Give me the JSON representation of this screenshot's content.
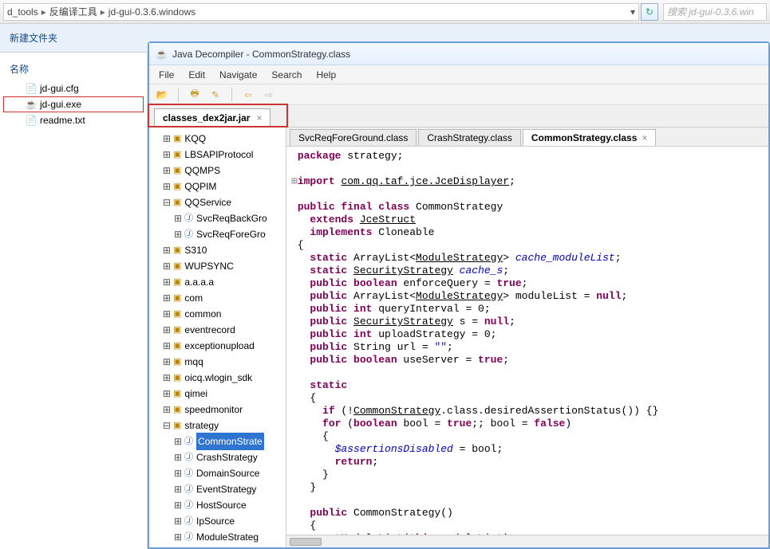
{
  "addr": {
    "seg1": "d_tools",
    "seg2": "反编译工具",
    "seg3": "jd-gui-0.3.6.windows"
  },
  "search_placeholder": "搜索 jd-gui-0.3.6.win",
  "exp_toolbar": {
    "new_folder": "新建文件夹"
  },
  "explorer": {
    "col_name": "名称",
    "files": [
      {
        "name": "jd-gui.cfg",
        "sel": false,
        "type": "file"
      },
      {
        "name": "jd-gui.exe",
        "sel": true,
        "type": "exe"
      },
      {
        "name": "readme.txt",
        "sel": false,
        "type": "file"
      }
    ]
  },
  "jd": {
    "title": "Java Decompiler - CommonStrategy.class",
    "menu": {
      "file": "File",
      "edit": "Edit",
      "navigate": "Navigate",
      "search": "Search",
      "help": "Help"
    },
    "file_tab": "classes_dex2jar.jar",
    "tree": [
      {
        "lvl": 1,
        "kind": "pkg",
        "exp": "+",
        "label": "KQQ"
      },
      {
        "lvl": 1,
        "kind": "pkg",
        "exp": "+",
        "label": "LBSAPIProtocol"
      },
      {
        "lvl": 1,
        "kind": "pkg",
        "exp": "+",
        "label": "QQMPS"
      },
      {
        "lvl": 1,
        "kind": "pkg",
        "exp": "+",
        "label": "QQPIM"
      },
      {
        "lvl": 1,
        "kind": "pkg",
        "exp": "-",
        "label": "QQService"
      },
      {
        "lvl": 2,
        "kind": "cls",
        "exp": "+",
        "label": "SvcReqBackGro"
      },
      {
        "lvl": 2,
        "kind": "cls",
        "exp": "+",
        "label": "SvcReqForeGro"
      },
      {
        "lvl": 1,
        "kind": "pkg",
        "exp": "+",
        "label": "S310"
      },
      {
        "lvl": 1,
        "kind": "pkg",
        "exp": "+",
        "label": "WUPSYNC"
      },
      {
        "lvl": 1,
        "kind": "pkg",
        "exp": "+",
        "label": "a.a.a.a"
      },
      {
        "lvl": 1,
        "kind": "pkg",
        "exp": "+",
        "label": "com"
      },
      {
        "lvl": 1,
        "kind": "pkg",
        "exp": "+",
        "label": "common"
      },
      {
        "lvl": 1,
        "kind": "pkg",
        "exp": "+",
        "label": "eventrecord"
      },
      {
        "lvl": 1,
        "kind": "pkg",
        "exp": "+",
        "label": "exceptionupload"
      },
      {
        "lvl": 1,
        "kind": "pkg",
        "exp": "+",
        "label": "mqq"
      },
      {
        "lvl": 1,
        "kind": "pkg",
        "exp": "+",
        "label": "oicq.wlogin_sdk"
      },
      {
        "lvl": 1,
        "kind": "pkg",
        "exp": "+",
        "label": "qimei"
      },
      {
        "lvl": 1,
        "kind": "pkg",
        "exp": "+",
        "label": "speedmonitor"
      },
      {
        "lvl": 1,
        "kind": "pkg",
        "exp": "-",
        "label": "strategy"
      },
      {
        "lvl": 2,
        "kind": "cls",
        "exp": "+",
        "label": "CommonStrate",
        "sel": true
      },
      {
        "lvl": 2,
        "kind": "cls",
        "exp": "+",
        "label": "CrashStrategy"
      },
      {
        "lvl": 2,
        "kind": "cls",
        "exp": "+",
        "label": "DomainSource"
      },
      {
        "lvl": 2,
        "kind": "cls",
        "exp": "+",
        "label": "EventStrategy"
      },
      {
        "lvl": 2,
        "kind": "cls",
        "exp": "+",
        "label": "HostSource"
      },
      {
        "lvl": 2,
        "kind": "cls",
        "exp": "+",
        "label": "IpSource"
      },
      {
        "lvl": 2,
        "kind": "cls",
        "exp": "+",
        "label": "ModuleStrateg"
      }
    ],
    "class_tabs": [
      {
        "label": "SvcReqForeGround.class",
        "active": false
      },
      {
        "label": "CrashStrategy.class",
        "active": false
      },
      {
        "label": "CommonStrategy.class",
        "active": true
      }
    ],
    "code": {
      "l1": "package strategy;",
      "l3": "import com.qq.taf.jce.JceDisplayer;",
      "l5": "public final class CommonStrategy",
      "l6": "  extends JceStruct",
      "l7": "  implements Cloneable",
      "l9": "  static ArrayList<ModuleStrategy> cache_moduleList;",
      "l10": "  static SecurityStrategy cache_s;",
      "l11": "  public boolean enforceQuery = true;",
      "l12": "  public ArrayList<ModuleStrategy> moduleList = null;",
      "l13": "  public int queryInterval = 0;",
      "l14": "  public SecurityStrategy s = null;",
      "l15": "  public int uploadStrategy = 0;",
      "l16": "  public String url = \"\";",
      "l17": "  public boolean useServer = true;",
      "l19": "  static",
      "l21": "    if (!CommonStrategy.class.desiredAssertionStatus()) {}",
      "l22": "    for (boolean bool = true;; bool = false)",
      "l24": "      $assertionsDisabled = bool;",
      "l25": "      return;",
      "l29": "  public CommonStrategy()",
      "l31": "    setModuleList(this.moduleList);"
    }
  }
}
